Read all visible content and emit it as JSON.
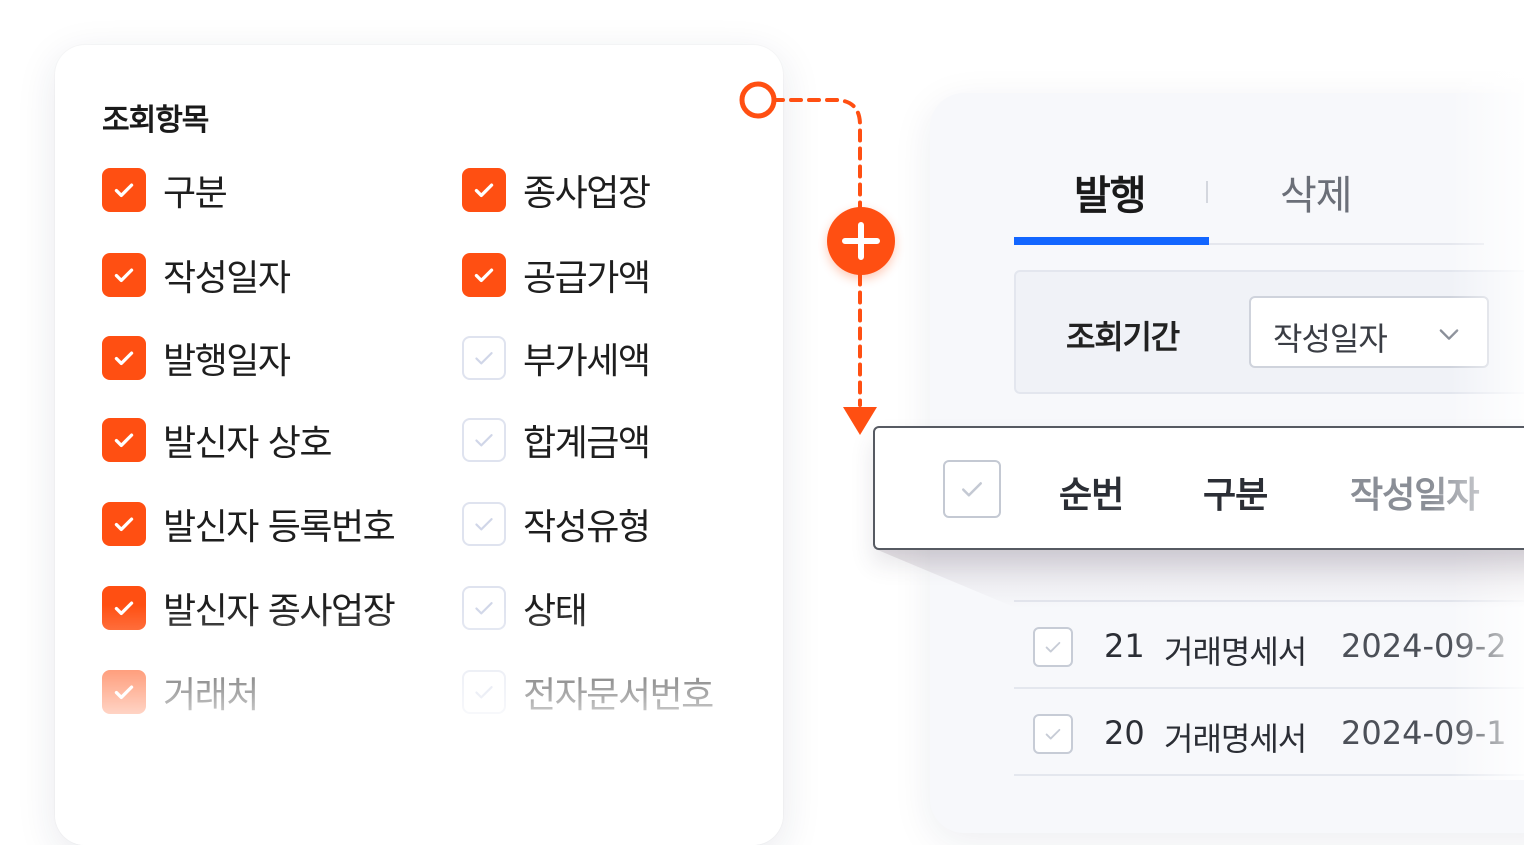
{
  "options_panel": {
    "title": "조회항목",
    "columns": [
      [
        {
          "label": "구분",
          "checked": true
        },
        {
          "label": "작성일자",
          "checked": true
        },
        {
          "label": "발행일자",
          "checked": true
        },
        {
          "label": "발신자 상호",
          "checked": true
        },
        {
          "label": "발신자 등록번호",
          "checked": true
        },
        {
          "label": "발신자 종사업장",
          "checked": true
        },
        {
          "label": "거래처",
          "checked": true
        }
      ],
      [
        {
          "label": "종사업장",
          "checked": true
        },
        {
          "label": "공급가액",
          "checked": true
        },
        {
          "label": "부가세액",
          "checked": false
        },
        {
          "label": "합계금액",
          "checked": false
        },
        {
          "label": "작성유형",
          "checked": false
        },
        {
          "label": "상태",
          "checked": false
        },
        {
          "label": "전자문서번호",
          "checked": false
        }
      ]
    ]
  },
  "colors": {
    "accent": "#ff4f12",
    "tab_active": "#1366ff"
  },
  "tabs": [
    {
      "label": "발행",
      "active": true
    },
    {
      "label": "삭제",
      "active": false
    }
  ],
  "filter": {
    "label": "조회기간",
    "select_value": "작성일자"
  },
  "table": {
    "headers": [
      "순번",
      "구분",
      "작성일자"
    ],
    "rows": [
      {
        "no": "21",
        "type": "거래명세서",
        "date": "2024-09-2"
      },
      {
        "no": "20",
        "type": "거래명세서",
        "date": "2024-09-1"
      }
    ]
  }
}
